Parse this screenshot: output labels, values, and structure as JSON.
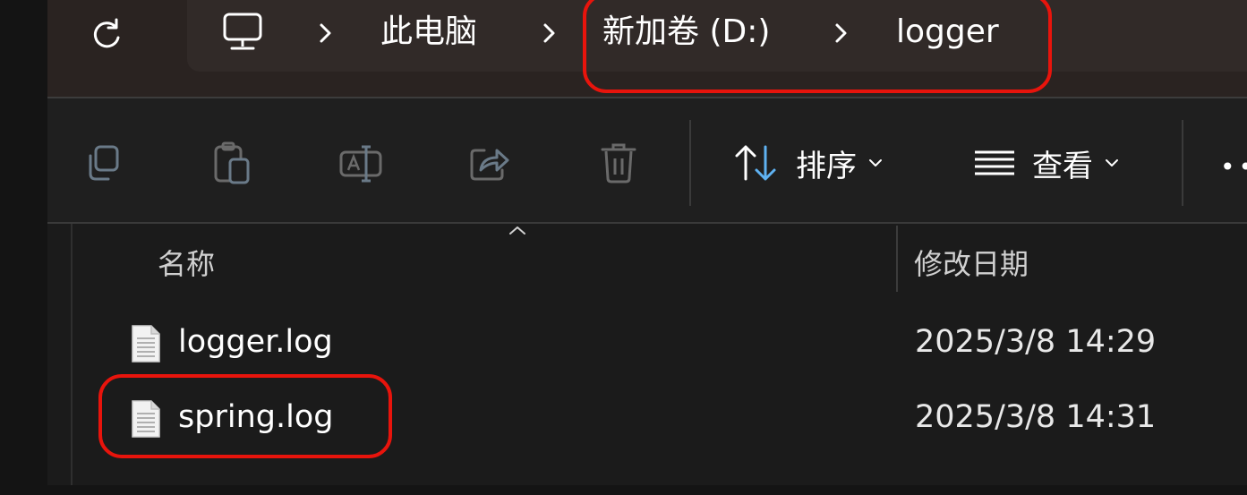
{
  "breadcrumb": {
    "pc_icon": "monitor-icon",
    "items": [
      "此电脑",
      "新加卷 (D:)",
      "logger"
    ]
  },
  "toolbar": {
    "sort_label": "排序",
    "view_label": "查看",
    "more_label": "••",
    "icons": [
      "copy-icon",
      "paste-icon",
      "rename-icon",
      "share-icon",
      "delete-icon",
      "sort-arrows-icon",
      "view-lines-icon"
    ]
  },
  "columns": {
    "name": "名称",
    "modified": "修改日期"
  },
  "files": [
    {
      "name": "logger.log",
      "modified": "2025/3/8 14:29",
      "icon": "text-file-icon"
    },
    {
      "name": "spring.log",
      "modified": "2025/3/8 14:31",
      "icon": "text-file-icon"
    }
  ],
  "annotation_color": "#e8140c",
  "accent_color": "#5fb2f2"
}
